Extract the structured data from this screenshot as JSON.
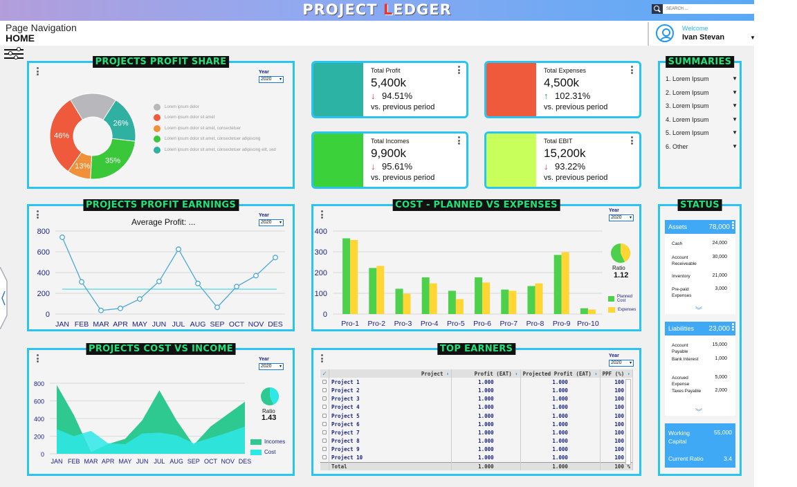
{
  "header": {
    "logo_pre": "PROJECT ",
    "logo_red": "L",
    "logo_post": "EDGER",
    "search_placeholder": "SEARCH ..."
  },
  "nav": {
    "title": "Page Navigation",
    "current": "HOME"
  },
  "user": {
    "welcome": "Welcome",
    "name": "Ivan Stevan"
  },
  "year_label": "Year",
  "year_value": "2020",
  "profit_share": {
    "title": "PROJECTS PROFIT SHARE",
    "legend": [
      {
        "label": "Lorem ipsum dolor",
        "color": "#b8b8bc"
      },
      {
        "label": "Lorem ipsum dolor sit amet",
        "color": "#f05a3c"
      },
      {
        "label": "Lorem ipsum dolor sit amet, consectetuer",
        "color": "#f0913a"
      },
      {
        "label": "Lorem ipsum dolor sit amet, consectetuer adipiscing",
        "color": "#3ac83a"
      },
      {
        "label": "Lorem ipsum dolor sit amet, consectetuer adipiscing elit, sed",
        "color": "#2fb0a0"
      }
    ]
  },
  "kpis": [
    {
      "label": "Total Profit",
      "value": "5,400k",
      "arrow": "↓",
      "arrow_color": "#e53935",
      "pct": "94.51%",
      "compare": "vs. previous period",
      "color": "#2cb3a3"
    },
    {
      "label": "Total Expenses",
      "value": "4,500k",
      "arrow": "↑",
      "arrow_color": "#2e9e3e",
      "pct": "102.31%",
      "compare": "vs. previous period",
      "color": "#f05a3c"
    },
    {
      "label": "Total Incomes",
      "value": "9,900k",
      "arrow": "↓",
      "arrow_color": "#e53935",
      "pct": "95.61%",
      "compare": "vs. previous period",
      "color": "#3ad13a"
    },
    {
      "label": "Total EBIT",
      "value": "15,200k",
      "arrow": "↓",
      "arrow_color": "#e53935",
      "pct": "93.22%",
      "compare": "vs. previous period",
      "color": "#c8ff5a"
    }
  ],
  "summaries": {
    "title": "SUMMARIES",
    "items": [
      "1. Lorem Ipsum",
      "2. Lorem Ipsum",
      "3. Lorem Ipsum",
      "4. Lorem Ipsum",
      "5. Lorem Ipsum",
      "6. Other"
    ]
  },
  "earnings": {
    "title": "PROJECTS PROFIT EARNINGS",
    "subtitle": "Average Profit: ..."
  },
  "cost_planned": {
    "title": "COST - PLANNED VS EXPENSES",
    "ratio_label": "Ratio",
    "ratio_value": "1.12"
  },
  "cost_income": {
    "title": "PROJECTS COST VS INCOME",
    "ratio_label": "Ratio",
    "ratio_value": "1.43"
  },
  "top_earners": {
    "title": "TOP EARNERS",
    "columns": [
      "Project",
      "Profit (EAT)",
      "Projected Profit (EAT)",
      "PPF (%)"
    ],
    "rows": [
      [
        "Project 1",
        "1.000",
        "1.000",
        "100 %"
      ],
      [
        "Project 2",
        "1.000",
        "1.000",
        "100 %"
      ],
      [
        "Project 3",
        "1.000",
        "1.000",
        "100 %"
      ],
      [
        "Project 4",
        "1.000",
        "1.000",
        "100 %"
      ],
      [
        "Project 5",
        "1.000",
        "1.000",
        "100 %"
      ],
      [
        "Project 6",
        "1.000",
        "1.000",
        "100 %"
      ],
      [
        "Project 7",
        "1.000",
        "1.000",
        "100 %"
      ],
      [
        "Project 8",
        "1.000",
        "1.000",
        "100 %"
      ],
      [
        "Project 9",
        "1.000",
        "1.000",
        "100 %"
      ],
      [
        "Project 10",
        "1.000",
        "1.000",
        "100 %"
      ]
    ],
    "total": [
      "Total",
      "1.000",
      "1.000",
      "100 %"
    ]
  },
  "status": {
    "title": "STATUS",
    "assets": {
      "label": "Assets",
      "value": "78,000",
      "rows": [
        [
          "Cash",
          "24,000"
        ],
        [
          "Account Receiveable",
          "30,000"
        ],
        [
          "Inventory",
          "21,000"
        ],
        [
          "Pre-paid Expenses",
          "3,000"
        ]
      ]
    },
    "liabilities": {
      "label": "Liabilities",
      "value": "23,000",
      "rows": [
        [
          "Account Payable",
          "15,000"
        ],
        [
          "Bank Interest",
          "1,000"
        ],
        [
          "Accrued Expense",
          "5,000"
        ],
        [
          "Taxes Payable",
          "2,000"
        ]
      ]
    },
    "working_capital_label": "Working Capital",
    "working_capital_value": "55,000",
    "current_ratio_label": "Current Ratio",
    "current_ratio_value": "3.4"
  },
  "chart_data": [
    {
      "type": "pie",
      "title": "PROJECTS PROFIT SHARE",
      "slices": [
        {
          "label": "Lorem ipsum dolor",
          "value": 26,
          "color": "#b8b8bc",
          "show": ""
        },
        {
          "label": "26%",
          "value": 26,
          "color": "#2fb0a0",
          "show": "26%"
        },
        {
          "label": "35%",
          "value": 35,
          "color": "#3ac83a",
          "show": "35%"
        },
        {
          "label": "13%",
          "value": 13,
          "color": "#f0913a",
          "show": "13%"
        },
        {
          "label": "46%",
          "value": 46,
          "color": "#f05a3c",
          "show": "46%"
        }
      ]
    },
    {
      "type": "line",
      "title": "Average Profit: ...",
      "categories": [
        "JAN",
        "FEB",
        "MAR",
        "APR",
        "MAY",
        "JUN",
        "JUL",
        "AUG",
        "SEP",
        "OCT",
        "NOV",
        "DES"
      ],
      "values": [
        740,
        310,
        35,
        55,
        145,
        315,
        625,
        295,
        65,
        265,
        370,
        545
      ],
      "average": 240,
      "ylim": [
        0,
        800
      ],
      "yticks": [
        0,
        200,
        400,
        600,
        800
      ]
    },
    {
      "type": "bar",
      "categories": [
        "Pro-1",
        "Pro-2",
        "Pro-3",
        "Pro-4",
        "Pro-5",
        "Pro-6",
        "Pro-7",
        "Pro-8",
        "Pro-9",
        "Pro-10"
      ],
      "series": [
        {
          "name": "Planned Cost",
          "color": "#4dd14d",
          "values": [
            365,
            222,
            122,
            177,
            112,
            177,
            118,
            135,
            285,
            28
          ]
        },
        {
          "name": "Expenses",
          "color": "#ffd633",
          "values": [
            357,
            232,
            98,
            148,
            72,
            152,
            112,
            148,
            298,
            22
          ]
        }
      ],
      "ylim": [
        0,
        400
      ],
      "yticks": [
        0,
        100,
        200,
        300,
        400
      ]
    },
    {
      "type": "area",
      "categories": [
        "JAN",
        "FEB",
        "MAR",
        "APR",
        "MAY",
        "JUN",
        "JUL",
        "AUG",
        "SEP",
        "OCT",
        "NOV",
        "DES"
      ],
      "series": [
        {
          "name": "Incomes",
          "color": "#2ec990",
          "values": [
            780,
            440,
            20,
            110,
            170,
            380,
            720,
            380,
            100,
            310,
            450,
            590
          ]
        },
        {
          "name": "Cost",
          "color": "#2ee8e8",
          "values": [
            280,
            200,
            260,
            120,
            110,
            230,
            240,
            210,
            120,
            180,
            240,
            310
          ]
        }
      ],
      "ylim": [
        0,
        800
      ],
      "yticks": [
        0,
        200,
        400,
        600,
        800
      ]
    }
  ]
}
